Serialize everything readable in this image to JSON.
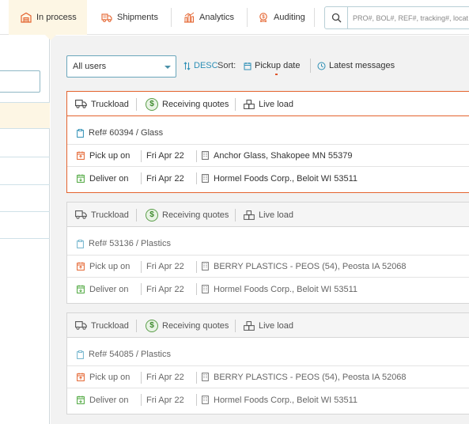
{
  "nav": {
    "tabs": [
      {
        "label": "In process",
        "icon": "warehouse-icon",
        "active": true
      },
      {
        "label": "Shipments",
        "icon": "truck-icon",
        "active": false
      },
      {
        "label": "Analytics",
        "icon": "chart-icon",
        "active": false
      },
      {
        "label": "Auditing",
        "icon": "audit-icon",
        "active": false
      }
    ],
    "search_placeholder": "PRO#, BOL#, REF#, tracking#, locat"
  },
  "toolbar": {
    "user_filter": "All users",
    "order": "DESC",
    "sort_label": "Sort:",
    "sort_field": "Pickup date",
    "latest_messages": "Latest messages"
  },
  "colors": {
    "accent_orange": "#e4632e",
    "accent_blue": "#2d8fb5",
    "quote_green": "#5b9e4a",
    "active_tab_bg": "#fdf6e4"
  },
  "loads": [
    {
      "mode": "Truckload",
      "status": "Receiving quotes",
      "load_type": "Live load",
      "ref": "Ref# 60394 / Glass",
      "pickup_label": "Pick up on",
      "pickup_date": "Fri Apr 22",
      "pickup_location": "Anchor Glass, Shakopee MN 55379",
      "deliver_label": "Deliver on",
      "deliver_date": "Fri Apr 22",
      "deliver_location": "Hormel Foods Corp., Beloit WI 53511"
    },
    {
      "mode": "Truckload",
      "status": "Receiving quotes",
      "load_type": "Live load",
      "ref": "Ref# 53136 / Plastics",
      "pickup_label": "Pick up on",
      "pickup_date": "Fri Apr 22",
      "pickup_location": "BERRY PLASTICS - PEOS (54), Peosta IA 52068",
      "deliver_label": "Deliver on",
      "deliver_date": "Fri Apr 22",
      "deliver_location": "Hormel Foods Corp., Beloit WI 53511"
    },
    {
      "mode": "Truckload",
      "status": "Receiving quotes",
      "load_type": "Live load",
      "ref": "Ref# 54085 / Plastics",
      "pickup_label": "Pick up on",
      "pickup_date": "Fri Apr 22",
      "pickup_location": "BERRY PLASTICS - PEOS (54), Peosta IA 52068",
      "deliver_label": "Deliver on",
      "deliver_date": "Fri Apr 22",
      "deliver_location": "Hormel Foods Corp., Beloit WI 53511"
    }
  ]
}
